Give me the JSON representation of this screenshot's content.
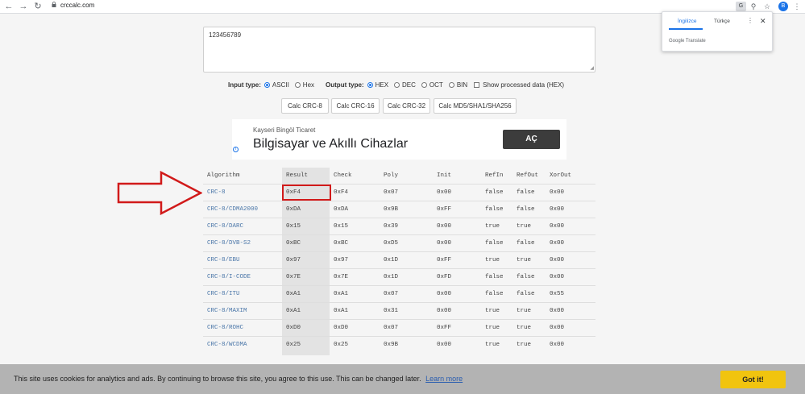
{
  "browser": {
    "url": "crccalc.com",
    "avatar_letter": "B"
  },
  "translate_popup": {
    "tab_active": "İngilizce",
    "tab_other": "Türkçe",
    "brand": "Google Translate"
  },
  "input": {
    "value": "123456789"
  },
  "options": {
    "input_type_label": "Input type:",
    "input_types": [
      "ASCII",
      "Hex"
    ],
    "input_type_selected": "ASCII",
    "output_type_label": "Output type:",
    "output_types": [
      "HEX",
      "DEC",
      "OCT",
      "BIN"
    ],
    "output_type_selected": "HEX",
    "show_processed_label": "Show processed data (HEX)"
  },
  "buttons": {
    "crc8": "Calc CRC-8",
    "crc16": "Calc CRC-16",
    "crc32": "Calc CRC-32",
    "md5": "Calc MD5/SHA1/SHA256"
  },
  "ad": {
    "small": "Kayseri Bingöl Ticaret",
    "big": "Bilgisayar ve Akıllı Cihazlar",
    "button": "AÇ",
    "info_icon": "i"
  },
  "table": {
    "headers": [
      "Algorithm",
      "Result",
      "Check",
      "Poly",
      "Init",
      "RefIn",
      "RefOut",
      "XorOut"
    ],
    "rows": [
      [
        "CRC-8",
        "0xF4",
        "0xF4",
        "0x07",
        "0x00",
        "false",
        "false",
        "0x00"
      ],
      [
        "CRC-8/CDMA2000",
        "0xDA",
        "0xDA",
        "0x9B",
        "0xFF",
        "false",
        "false",
        "0x00"
      ],
      [
        "CRC-8/DARC",
        "0x15",
        "0x15",
        "0x39",
        "0x00",
        "true",
        "true",
        "0x00"
      ],
      [
        "CRC-8/DVB-S2",
        "0xBC",
        "0xBC",
        "0xD5",
        "0x00",
        "false",
        "false",
        "0x00"
      ],
      [
        "CRC-8/EBU",
        "0x97",
        "0x97",
        "0x1D",
        "0xFF",
        "true",
        "true",
        "0x00"
      ],
      [
        "CRC-8/I-CODE",
        "0x7E",
        "0x7E",
        "0x1D",
        "0xFD",
        "false",
        "false",
        "0x00"
      ],
      [
        "CRC-8/ITU",
        "0xA1",
        "0xA1",
        "0x07",
        "0x00",
        "false",
        "false",
        "0x55"
      ],
      [
        "CRC-8/MAXIM",
        "0xA1",
        "0xA1",
        "0x31",
        "0x00",
        "true",
        "true",
        "0x00"
      ],
      [
        "CRC-8/ROHC",
        "0xD0",
        "0xD0",
        "0x07",
        "0xFF",
        "true",
        "true",
        "0x00"
      ],
      [
        "CRC-8/WCDMA",
        "0x25",
        "0x25",
        "0x9B",
        "0x00",
        "true",
        "true",
        "0x00"
      ]
    ]
  },
  "cookie": {
    "text": "This site uses cookies for analytics and ads. By continuing to browse this site, you agree to this use. This can be changed later.",
    "link": "Learn more",
    "button": "Got it!"
  },
  "colors": {
    "link": "#4a76a8",
    "highlight_red": "#d11a1a",
    "cookie_button": "#f1c40f",
    "radio_accent": "#1a73e8"
  }
}
